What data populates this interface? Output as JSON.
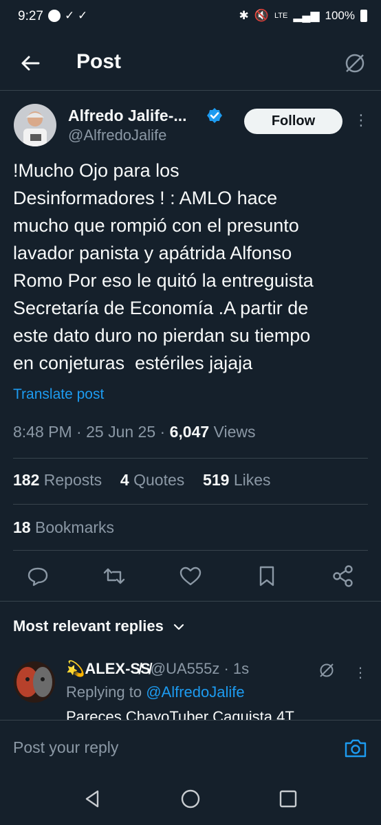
{
  "status_bar": {
    "time": "9:27",
    "notif_icons": "✓ ✓",
    "battery": "100%",
    "network": "LTE"
  },
  "header": {
    "title": "Post"
  },
  "post": {
    "author_name": "Alfredo Jalife-...",
    "author_handle": "@AlfredoJalife",
    "follow_label": "Follow",
    "text": "!Mucho Ojo para los\nDesinformadores ! : AMLO hace\nmucho que rompió con el presunto\nlavador panista y apátrida Alfonso\nRomo Por eso le quitó la entreguista\nSecretaría de Economía .A partir de\neste dato duro no pierdan su tiempo\nen conjeturas  estériles jajaja",
    "translate_label": "Translate post",
    "time": "8:48 PM",
    "date": "25 Jun 25",
    "views_count": "6,047",
    "views_label": "Views",
    "reposts_count": "182",
    "reposts_label": "Reposts",
    "quotes_count": "4",
    "quotes_label": "Quotes",
    "likes_count": "519",
    "likes_label": "Likes",
    "bookmarks_count": "18",
    "bookmarks_label": "Bookmarks"
  },
  "replies": {
    "sort_label": "Most relevant replies",
    "items": [
      {
        "name": "💫ALEX-S̸S̸",
        "handle": "@UA555z",
        "time": "1s",
        "replying_to_label": "Replying to",
        "replying_to_handle": "@AlfredoJalife",
        "text": "Pareces ChavoTuber Caquista 4T"
      }
    ]
  },
  "composer": {
    "placeholder": "Post your reply"
  },
  "colors": {
    "background": "#15202b",
    "accent": "#1d9bf0",
    "muted": "#8b98a5"
  }
}
